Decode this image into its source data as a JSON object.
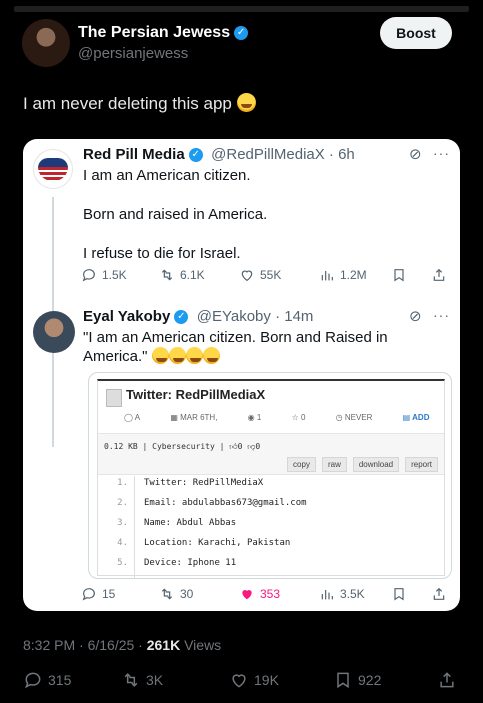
{
  "post": {
    "author_name": "The Persian Jewess",
    "author_handle": "@persianjewess",
    "boost_label": "Boost",
    "text": "I am never deleting this app",
    "emoji": "rolling-on-floor-laughing",
    "timestamp": "8:32 PM · 6/16/25 · ",
    "views_count": "261K",
    "views_label": "Views",
    "replies": "315",
    "reposts": "3K",
    "likes": "19K",
    "bookmarks": "922"
  },
  "quote1": {
    "author_name": "Red Pill Media",
    "handle_time": "@RedPillMediaX · 6h",
    "line1": "I am an American citizen.",
    "line2": "Born and raised in America.",
    "line3": "I refuse to die for Israel.",
    "replies": "1.5K",
    "reposts": "6.1K",
    "likes": "55K",
    "views": "1.2M"
  },
  "quote2": {
    "author_name": "Eyal Yakoby",
    "handle_time": "@EYakoby · 14m",
    "text": "\"I am an American citizen. Born and Raised in America.\"",
    "emojis": [
      "clown-face",
      "clown-face",
      "clown-face",
      "clown-face"
    ],
    "replies": "15",
    "reposts": "30",
    "likes": "353",
    "views": "3.5K",
    "like_color": "#f91880"
  },
  "paste": {
    "title": "Twitter: RedPillMediaX",
    "meta": [
      "A",
      "MAR 6TH,",
      "1",
      "0",
      "NEVER",
      "ADD"
    ],
    "size_line": "0.12 KB | Cybersecurity |",
    "up_votes": "0",
    "down_votes": "0",
    "buttons": [
      "copy",
      "raw",
      "download",
      "report"
    ],
    "lines": [
      {
        "n": "1.",
        "t": "Twitter: RedPillMediaX"
      },
      {
        "n": "2.",
        "t": "Email: abdulabbas673@gmail.com"
      },
      {
        "n": "3.",
        "t": "Name: Abdul Abbas"
      },
      {
        "n": "4.",
        "t": "Location: Karachi, Pakistan"
      },
      {
        "n": "5.",
        "t": "Device: Iphone 11"
      }
    ]
  },
  "colors": {
    "verified": "#1d9bf0",
    "background": "#000000",
    "card": "#ffffff"
  }
}
